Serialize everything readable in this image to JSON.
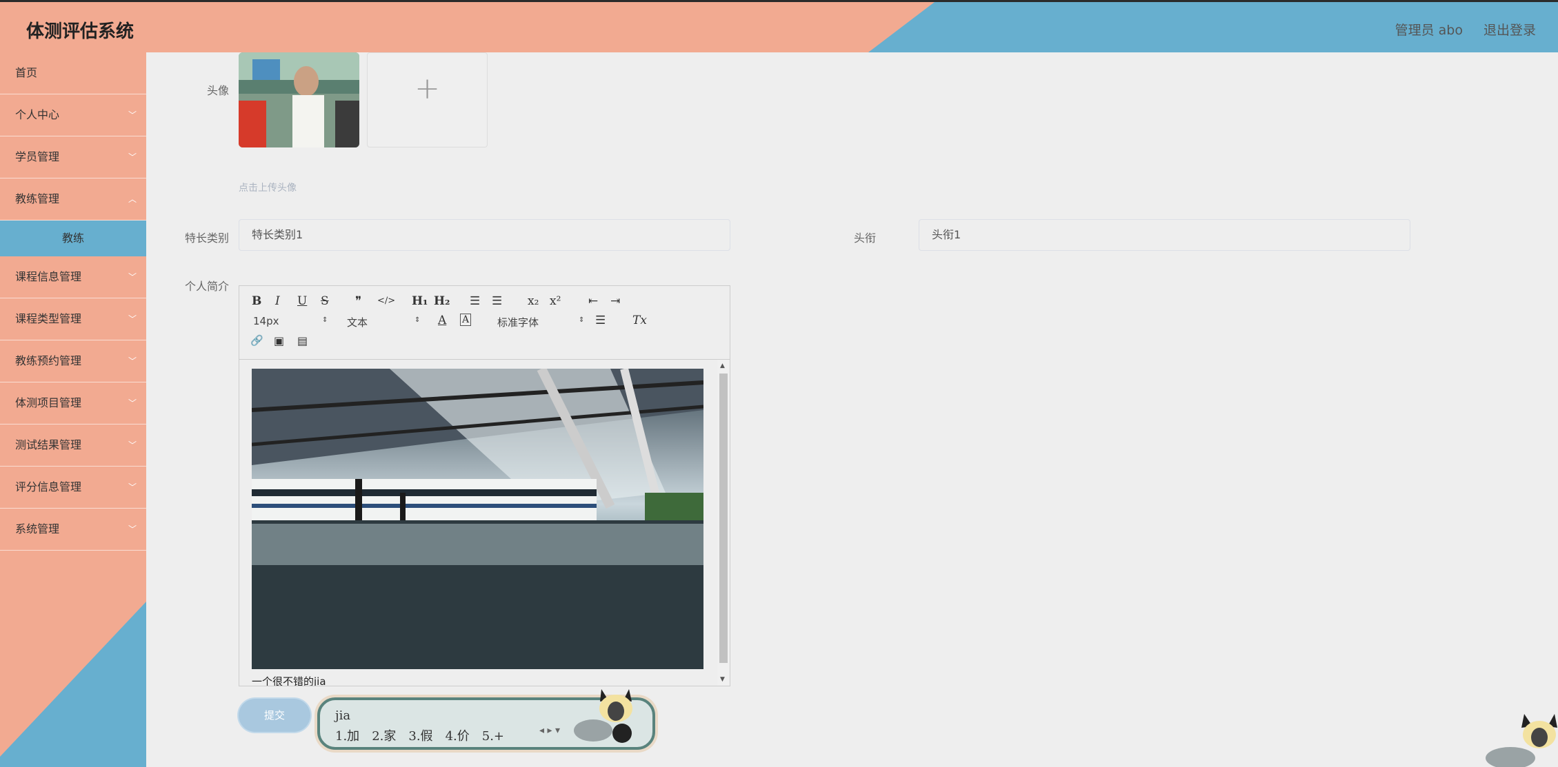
{
  "header": {
    "title": "体测评估系统",
    "user": "管理员 abo",
    "logout": "退出登录"
  },
  "sidebar": {
    "items": [
      {
        "label": "首页"
      },
      {
        "label": "个人中心"
      },
      {
        "label": "学员管理"
      },
      {
        "label": "教练管理"
      },
      {
        "label": "课程信息管理"
      },
      {
        "label": "课程类型管理"
      },
      {
        "label": "教练预约管理"
      },
      {
        "label": "体测项目管理"
      },
      {
        "label": "测试结果管理"
      },
      {
        "label": "评分信息管理"
      },
      {
        "label": "系统管理"
      }
    ],
    "active_sub": "教练"
  },
  "form": {
    "avatar_label": "头像",
    "upload_plus": "+",
    "upload_hint": "点击上传头像",
    "specialty_label": "特长类别",
    "specialty_value": "特长类别1",
    "title_label": "头衔",
    "title_value": "头衔1",
    "intro_label": "个人简介",
    "editor": {
      "bold": "B",
      "italic": "I",
      "underline": "U",
      "strike": "S",
      "quote": "❞",
      "code": "</>",
      "h1": "H₁",
      "h2": "H₂",
      "ol": "☰",
      "ul": "☰",
      "sub": "x₂",
      "sup": "x²",
      "outdent": "⇤",
      "indent": "⇥",
      "size": "14px",
      "header": "文本",
      "color": "A",
      "bg": "A",
      "font": "标准字体",
      "align": "☰",
      "clean": "Tx",
      "link": "🔗",
      "image": "▣",
      "video": "▤",
      "content_text": "一个很不错的jia"
    },
    "submit": "提交"
  },
  "ime": {
    "composition": "jia",
    "candidates": [
      "1.加",
      "2.家",
      "3.假",
      "4.价",
      "5.+"
    ],
    "nav": "◂ ▸ ▾"
  }
}
